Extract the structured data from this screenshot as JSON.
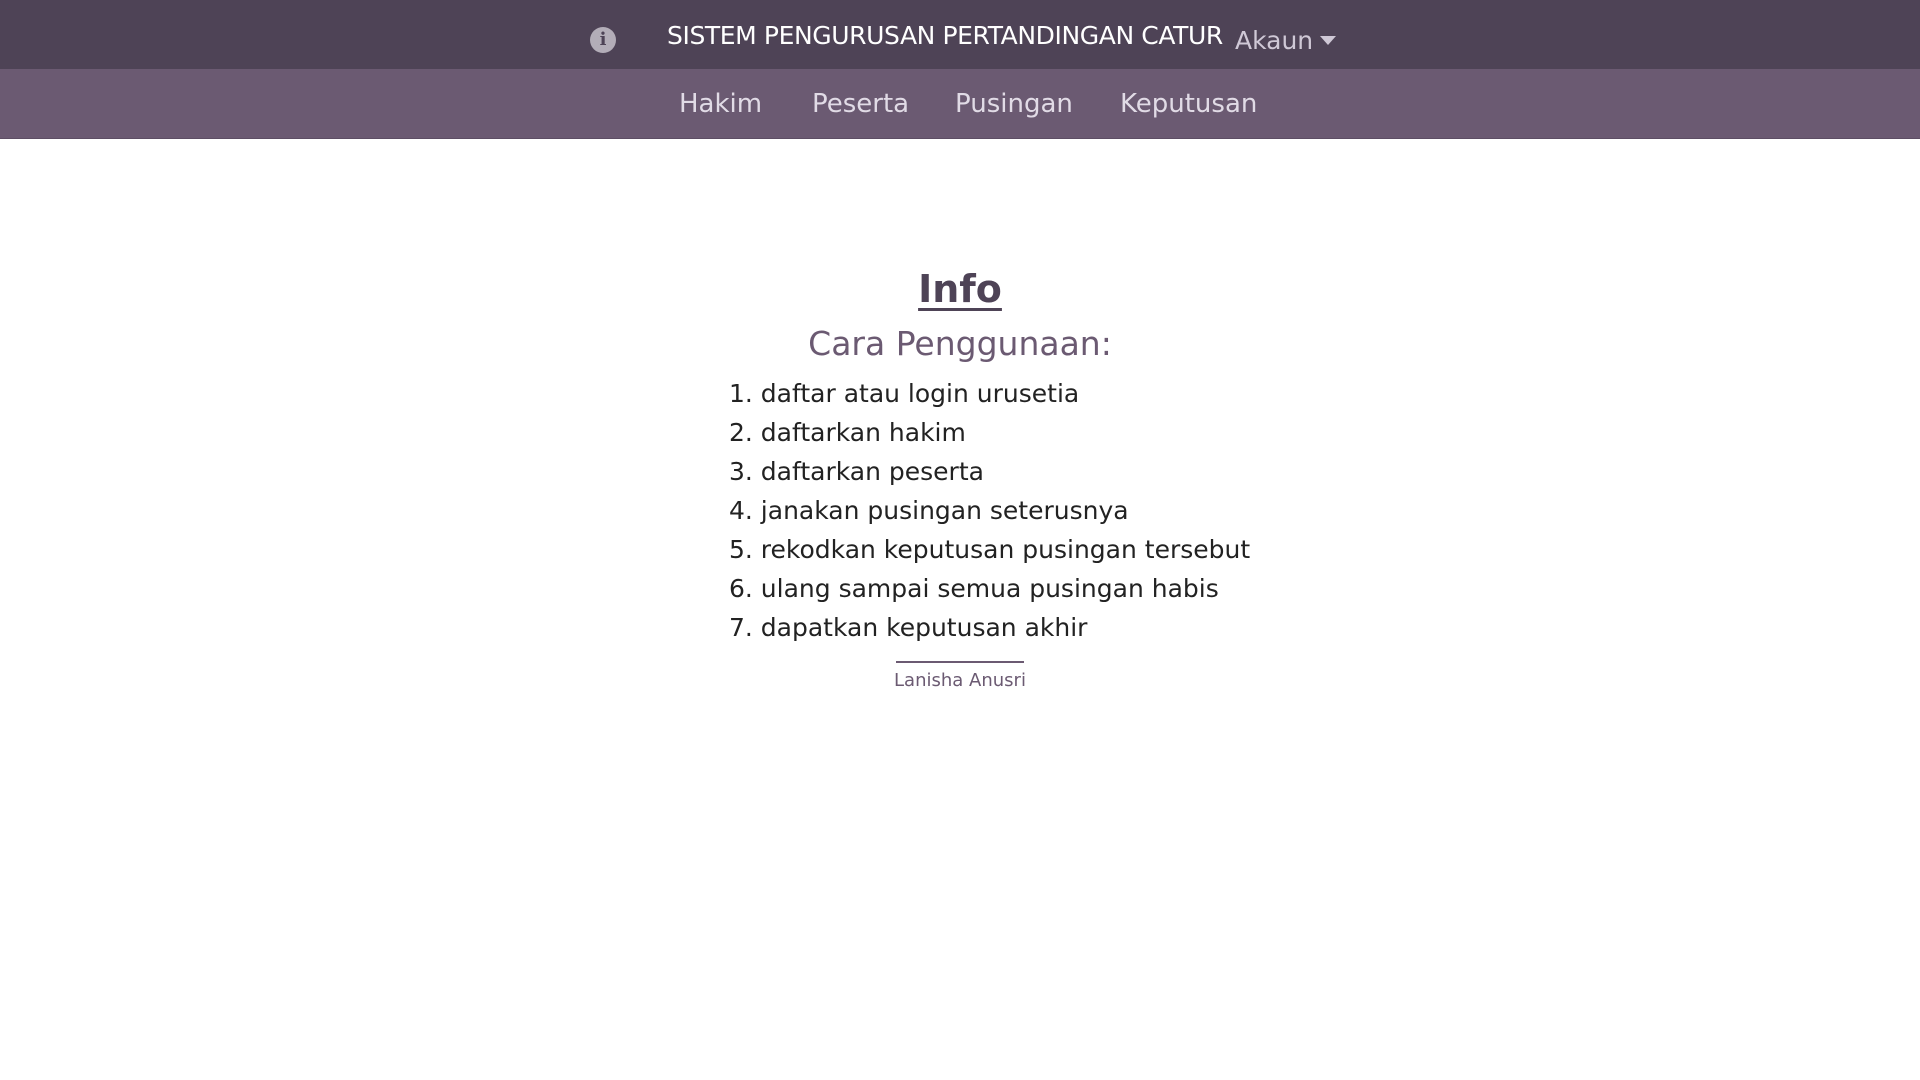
{
  "header": {
    "info_icon_glyph": "i",
    "title": "SISTEM PENGURUSAN PERTANDINGAN CATUR",
    "account_label": "Akaun",
    "background_color": "#4e4356"
  },
  "nav": {
    "background_color": "#6b5a72",
    "items": [
      {
        "label": "Hakim"
      },
      {
        "label": "Peserta"
      },
      {
        "label": "Pusingan"
      },
      {
        "label": "Keputusan"
      }
    ]
  },
  "content": {
    "heading": "Info",
    "subheading": "Cara Penggunaan:",
    "steps": [
      "1. daftar atau login urusetia",
      "2. daftarkan hakim",
      "3. daftarkan peserta",
      "4. janakan pusingan seterusnya",
      "5. rekodkan keputusan pusingan tersebut",
      "6. ulang sampai semua pusingan habis",
      "7. dapatkan keputusan akhir"
    ],
    "author": "Lanisha Anusri"
  }
}
